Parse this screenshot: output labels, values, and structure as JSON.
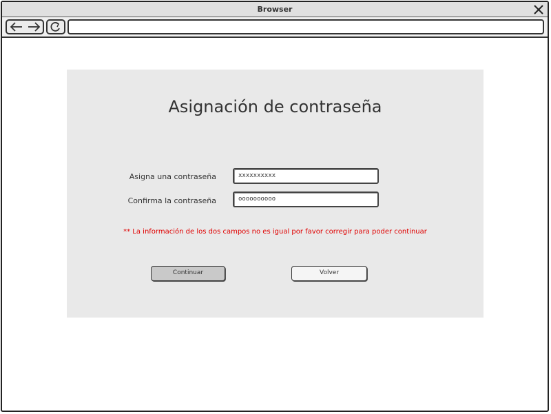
{
  "browser": {
    "title": "Browser",
    "url": ""
  },
  "form": {
    "heading": "Asignación de contraseña",
    "password_label": "Asigna una contraseña",
    "password_value": "xxxxxxxxxx",
    "confirm_label": "Confirma la contraseña",
    "confirm_value": "oooooooooo",
    "error_message": "** La información de los dos campos no es  igual por favor corregir para poder continuar",
    "continue_label": "Continuar",
    "back_label": "Volver"
  },
  "colors": {
    "error": "#e00000",
    "panel_bg": "#e9e9e9"
  }
}
